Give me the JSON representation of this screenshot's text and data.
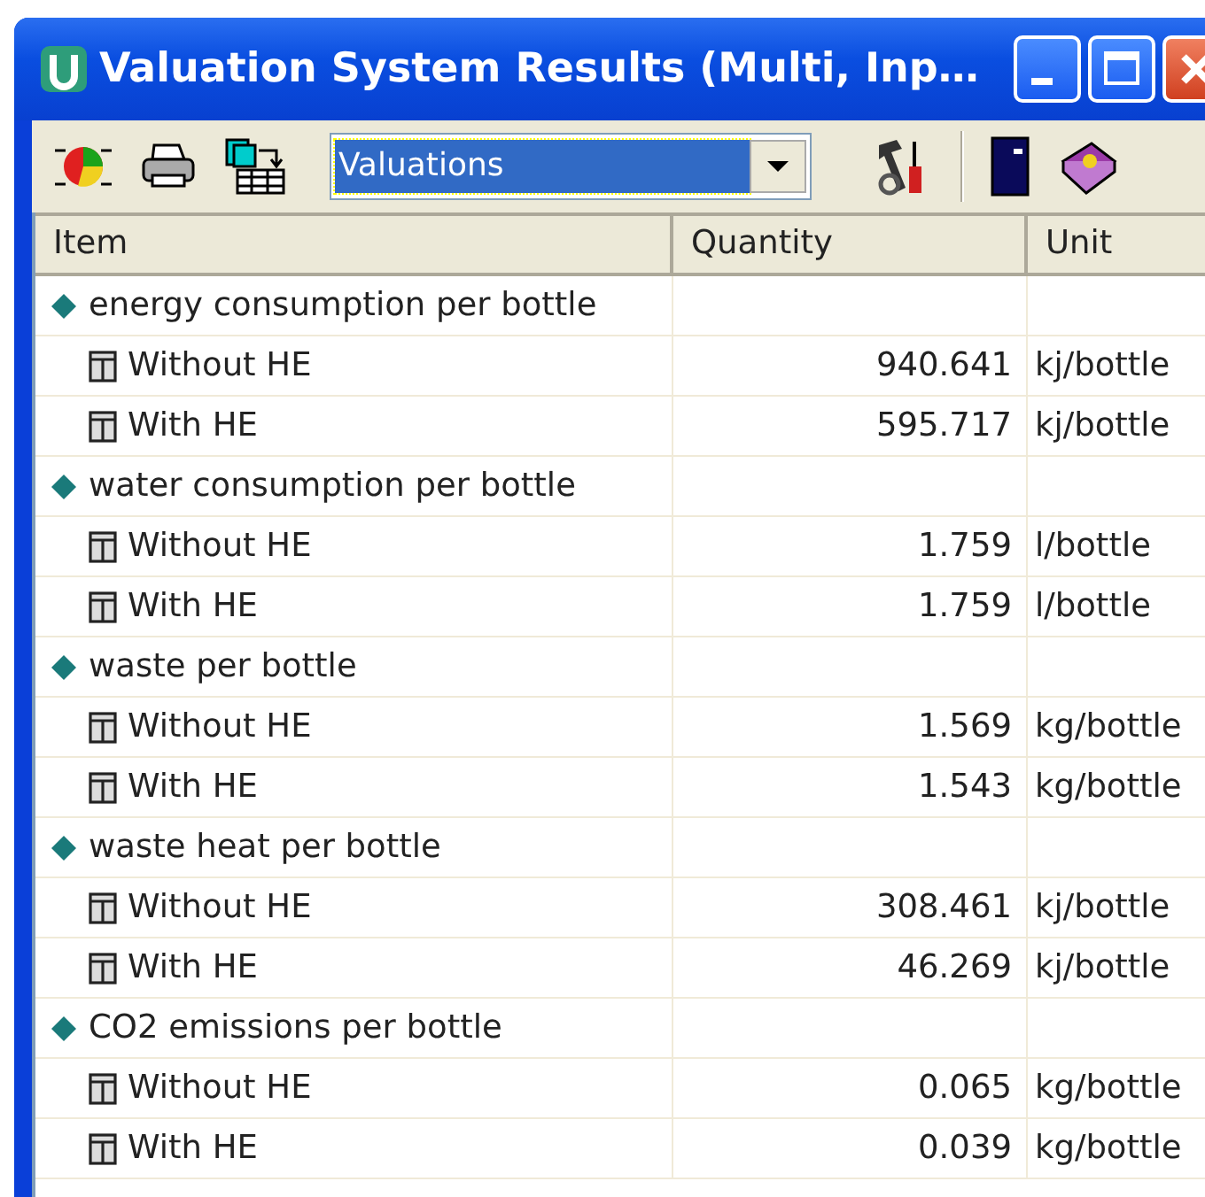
{
  "window": {
    "title": "Valuation System Results (Multi, Inp…"
  },
  "toolbar": {
    "dropdown": {
      "value": "Valuations",
      "selected": true
    }
  },
  "table": {
    "columns": [
      "Item",
      "Quantity",
      "Unit"
    ],
    "rows": [
      {
        "item": "energy consumption per bottle",
        "children": [
          {
            "item": "Without HE",
            "quantity": "940.641",
            "unit": "kj/bottle"
          },
          {
            "item": "With HE",
            "quantity": "595.717",
            "unit": "kj/bottle"
          }
        ]
      },
      {
        "item": "water consumption per bottle",
        "children": [
          {
            "item": "Without HE",
            "quantity": "1.759",
            "unit": "l/bottle"
          },
          {
            "item": "With HE",
            "quantity": "1.759",
            "unit": "l/bottle"
          }
        ]
      },
      {
        "item": "waste per bottle",
        "children": [
          {
            "item": "Without HE",
            "quantity": "1.569",
            "unit": "kg/bottle"
          },
          {
            "item": "With HE",
            "quantity": "1.543",
            "unit": "kg/bottle"
          }
        ]
      },
      {
        "item": "waste heat per bottle",
        "children": [
          {
            "item": "Without HE",
            "quantity": "308.461",
            "unit": "kj/bottle"
          },
          {
            "item": "With HE",
            "quantity": "46.269",
            "unit": "kj/bottle"
          }
        ]
      },
      {
        "item": "CO2 emissions per bottle",
        "children": [
          {
            "item": "Without HE",
            "quantity": "0.065",
            "unit": "kg/bottle"
          },
          {
            "item": "With HE",
            "quantity": "0.039",
            "unit": "kg/bottle"
          }
        ]
      }
    ]
  }
}
